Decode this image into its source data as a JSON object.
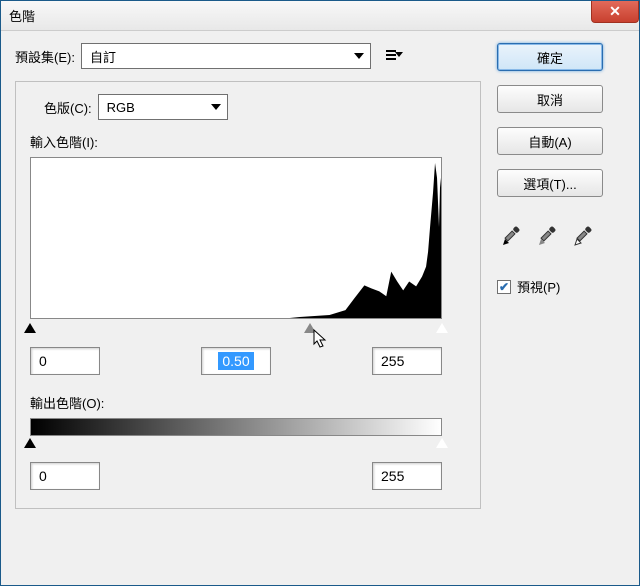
{
  "window": {
    "title": "色階"
  },
  "preset": {
    "label": "預設集(E):",
    "value": "自訂"
  },
  "channel": {
    "label": "色版(C):",
    "value": "RGB"
  },
  "input_levels": {
    "label": "輸入色階(I):",
    "shadow": "0",
    "midtone": "0.50",
    "highlight": "255",
    "midtone_slider_percent": 68
  },
  "output_levels": {
    "label": "輸出色階(O):",
    "shadow": "0",
    "highlight": "255"
  },
  "buttons": {
    "ok": "確定",
    "cancel": "取消",
    "auto": "自動(A)",
    "options": "選項(T)..."
  },
  "preview": {
    "label": "預視(P)",
    "checked": true
  },
  "close_glyph": "✕",
  "chart_data": {
    "type": "area",
    "title": "輸入色階(I)",
    "xlabel": "",
    "ylabel": "",
    "xlim": [
      0,
      255
    ],
    "ylim": [
      0,
      1
    ],
    "note": "Image histogram. Pixels are concentrated heavily in the bright range; low values have essentially zero count. Values are relative heights (0–1) estimated from the plot.",
    "x": [
      0,
      16,
      32,
      48,
      64,
      80,
      96,
      112,
      128,
      144,
      160,
      168,
      176,
      184,
      192,
      200,
      208,
      216,
      222,
      228,
      232,
      236,
      240,
      244,
      246,
      248,
      250,
      251,
      252,
      253,
      254,
      255
    ],
    "values": [
      0,
      0,
      0,
      0,
      0,
      0,
      0,
      0,
      0,
      0,
      0,
      0.01,
      0.015,
      0.02,
      0.05,
      0.12,
      0.2,
      0.18,
      0.14,
      0.3,
      0.23,
      0.17,
      0.25,
      0.2,
      0.33,
      0.3,
      0.45,
      0.6,
      0.8,
      0.95,
      1.0,
      0.95
    ]
  }
}
